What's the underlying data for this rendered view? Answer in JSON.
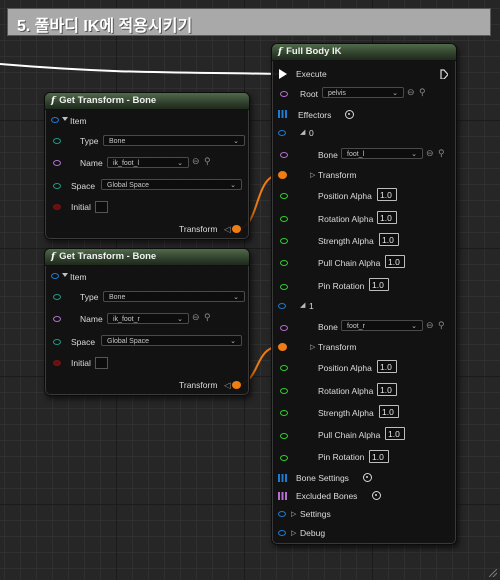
{
  "header": {
    "title": "5. 풀바디 IK에 적용시키기"
  },
  "get_transform_1": {
    "title": "Get Transform - Bone",
    "item_label": "Item",
    "type_label": "Type",
    "type_value": "Bone",
    "name_label": "Name",
    "name_value": "ik_foot_l",
    "space_label": "Space",
    "space_value": "Global Space",
    "initial_label": "Initial",
    "transform_label": "Transform"
  },
  "get_transform_2": {
    "title": "Get Transform - Bone",
    "item_label": "Item",
    "type_label": "Type",
    "type_value": "Bone",
    "name_label": "Name",
    "name_value": "ik_foot_r",
    "space_label": "Space",
    "space_value": "Global Space",
    "initial_label": "Initial",
    "transform_label": "Transform"
  },
  "full_body_ik": {
    "title": "Full Body IK",
    "execute_label": "Execute",
    "root_label": "Root",
    "root_value": "pelvis",
    "effectors_label": "Effectors",
    "effectors": [
      {
        "index": "0",
        "bone_label": "Bone",
        "bone_value": "foot_l",
        "transform_label": "Transform",
        "position_alpha_label": "Position Alpha",
        "position_alpha": "1.0",
        "rotation_alpha_label": "Rotation Alpha",
        "rotation_alpha": "1.0",
        "strength_alpha_label": "Strength Alpha",
        "strength_alpha": "1.0",
        "pull_chain_alpha_label": "Pull Chain Alpha",
        "pull_chain_alpha": "1.0",
        "pin_rotation_label": "Pin Rotation",
        "pin_rotation": "1.0"
      },
      {
        "index": "1",
        "bone_label": "Bone",
        "bone_value": "foot_r",
        "transform_label": "Transform",
        "position_alpha_label": "Position Alpha",
        "position_alpha": "1.0",
        "rotation_alpha_label": "Rotation Alpha",
        "rotation_alpha": "1.0",
        "strength_alpha_label": "Strength Alpha",
        "strength_alpha": "1.0",
        "pull_chain_alpha_label": "Pull Chain Alpha",
        "pull_chain_alpha": "1.0",
        "pin_rotation_label": "Pin Rotation",
        "pin_rotation": "1.0"
      }
    ],
    "bone_settings_label": "Bone Settings",
    "excluded_bones_label": "Excluded Bones",
    "settings_label": "Settings",
    "debug_label": "Debug"
  },
  "colors": {
    "exec_wire": "#ffffff",
    "transform_wire": "#f07d12",
    "struct_pin": "#1e7bd3",
    "name_pin": "#b46fcf",
    "float_pin": "#2fcf2f",
    "bool_pin": "#7a1313"
  }
}
